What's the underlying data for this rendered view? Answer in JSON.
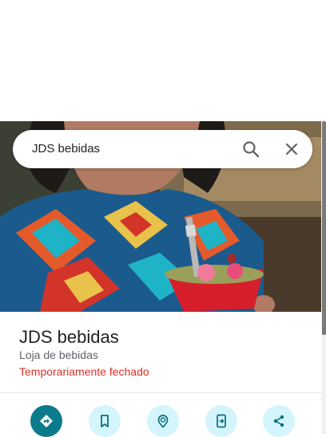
{
  "search": {
    "query": "JDS bebidas"
  },
  "place": {
    "name": "JDS bebidas",
    "category": "Loja de bebidas",
    "status": "Temporariamente fechado"
  },
  "colors": {
    "accent": "#0b7b8b",
    "action_bg": "#d3f5fb",
    "status_closed": "#d93025"
  },
  "actions": [
    {
      "icon": "directions-icon"
    },
    {
      "icon": "bookmark-icon"
    },
    {
      "icon": "nearby-icon"
    },
    {
      "icon": "send-to-phone-icon"
    },
    {
      "icon": "share-icon"
    }
  ]
}
